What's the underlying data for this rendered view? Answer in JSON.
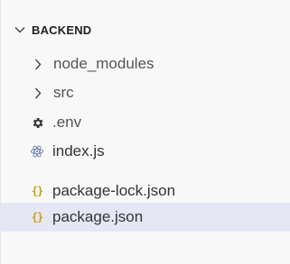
{
  "explorer": {
    "section_title": "BACKEND",
    "items": [
      {
        "label": "node_modules",
        "kind": "folder",
        "icon": "chevron-right-icon"
      },
      {
        "label": "src",
        "kind": "folder",
        "icon": "chevron-right-icon"
      },
      {
        "label": ".env",
        "kind": "file",
        "icon": "gear-icon"
      },
      {
        "label": "index.js",
        "kind": "file",
        "icon": "react-atom-icon"
      },
      {
        "label": "package-lock.json",
        "kind": "file",
        "icon": "json-braces-icon",
        "icon_glyph": "{}"
      },
      {
        "label": "package.json",
        "kind": "file",
        "icon": "json-braces-icon",
        "icon_glyph": "{}",
        "selected": true
      }
    ]
  },
  "colors": {
    "selected_background": "#e5e7f5",
    "json_icon": "#c9a20a",
    "react_icon": "#6b7fa8",
    "gear_icon": "#3a3a3a",
    "text": "#333333"
  }
}
